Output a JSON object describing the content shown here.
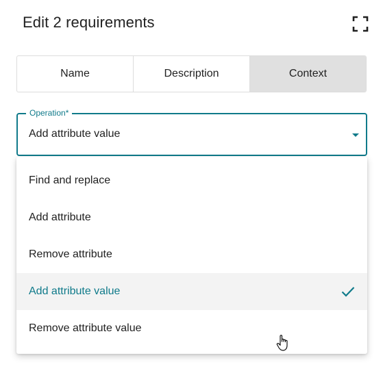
{
  "dialog": {
    "title": "Edit 2 requirements"
  },
  "icons": {
    "expand": "fullscreen-expand-icon",
    "caret": "dropdown-arrow-icon",
    "check": "checkmark-icon",
    "cursor": "hand-pointer-cursor-icon"
  },
  "colors": {
    "accent": "#0f7a8a",
    "active_tab_bg": "#e0e0e0",
    "selected_item_bg": "#f3f3f3"
  },
  "tabs": [
    {
      "label": "Name"
    },
    {
      "label": "Description"
    },
    {
      "label": "Context",
      "active": true
    }
  ],
  "operation_field": {
    "label": "Operation*",
    "value": "Add attribute value"
  },
  "operation_options": [
    {
      "label": "Find and replace"
    },
    {
      "label": "Add attribute"
    },
    {
      "label": "Remove attribute"
    },
    {
      "label": "Add attribute value",
      "selected": true
    },
    {
      "label": "Remove attribute value"
    }
  ]
}
